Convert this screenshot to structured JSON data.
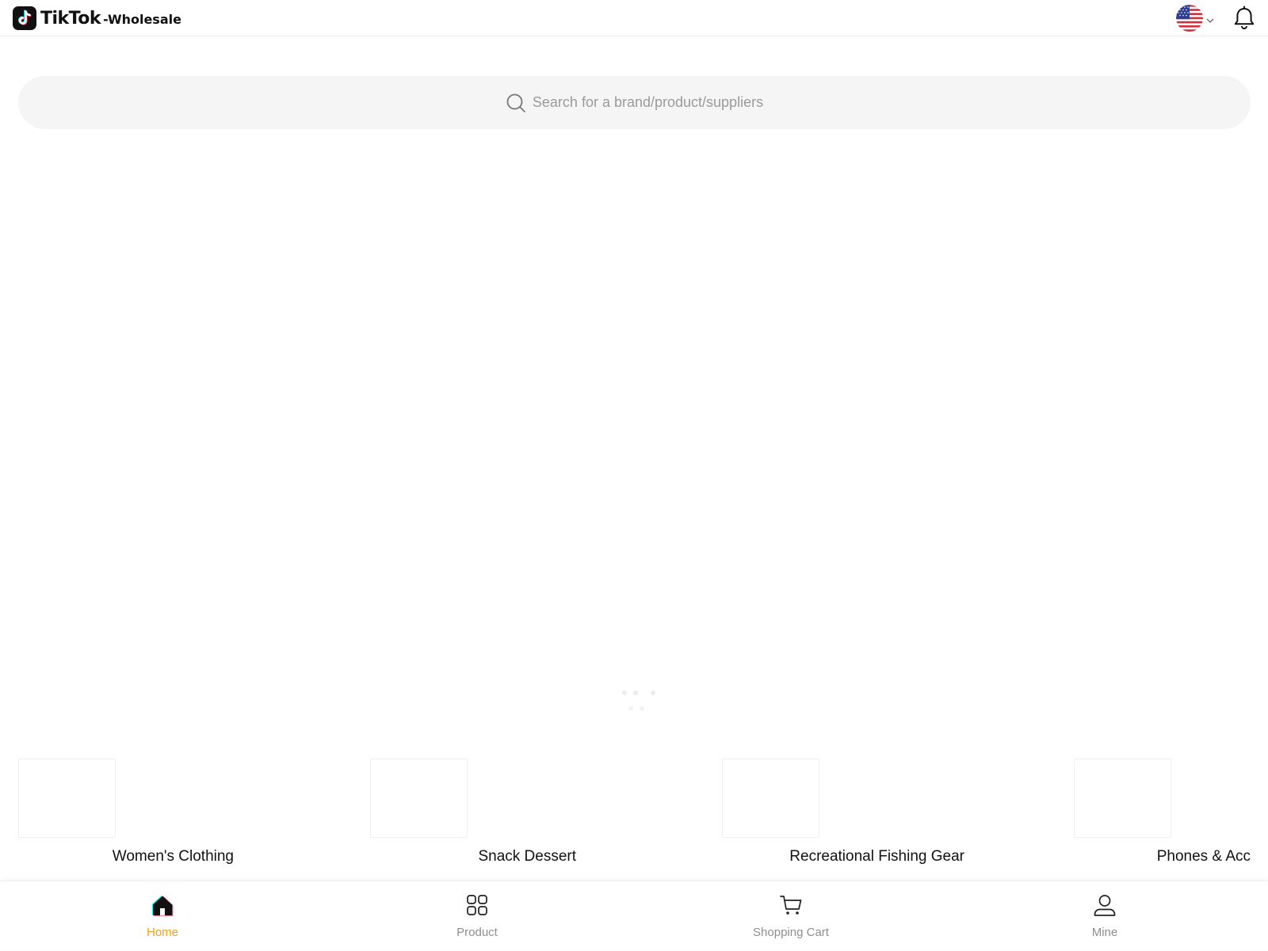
{
  "header": {
    "brand_name": "TikTok",
    "brand_suffix": "-Wholesale",
    "language_flag": "us-flag-icon",
    "notification_icon": "bell-icon"
  },
  "search": {
    "placeholder": "Search for a brand/product/suppliers",
    "icon": "search-icon"
  },
  "categories": [
    {
      "label": "Women's Clothing"
    },
    {
      "label": "Snack Dessert"
    },
    {
      "label": "Recreational Fishing Gear"
    },
    {
      "label": "Phones & Acc"
    }
  ],
  "bottom_nav": {
    "items": [
      {
        "label": "Home",
        "icon": "home-icon",
        "active": true
      },
      {
        "label": "Product",
        "icon": "grid-icon",
        "active": false
      },
      {
        "label": "Shopping Cart",
        "icon": "cart-icon",
        "active": false
      },
      {
        "label": "Mine",
        "icon": "user-icon",
        "active": false
      }
    ]
  },
  "colors": {
    "active_nav": "#f0a21a",
    "inactive_nav": "#8e8e8e",
    "search_bg": "#f5f5f5",
    "tiktok_cyan": "#25f4ee",
    "tiktok_red": "#fe2c55"
  }
}
